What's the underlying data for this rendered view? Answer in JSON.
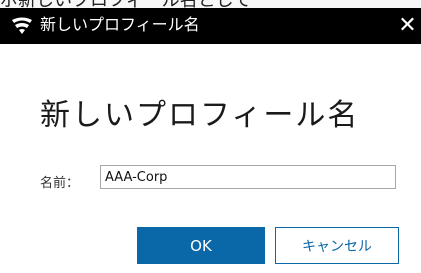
{
  "window": {
    "title": "新しいプロフィール名",
    "top_strip_text": "ポ新しいプロフィール名として"
  },
  "icons": {
    "app": "wifi-shield-icon",
    "close": "close-icon"
  },
  "dialog": {
    "heading": "新しいプロフィール名",
    "name_label": "名前：",
    "name_value": "AAA-Corp",
    "ok_label": "OK",
    "cancel_label": "キャンセル"
  },
  "colors": {
    "titlebar": "#000000",
    "accent": "#0a67a8",
    "background": "#ffffff"
  }
}
